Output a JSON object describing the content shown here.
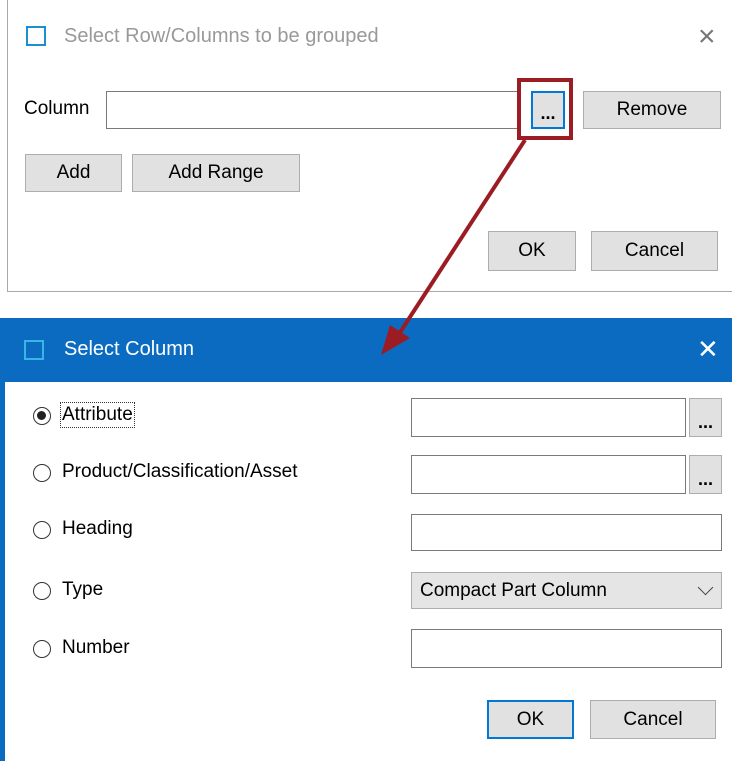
{
  "dialog_group": {
    "title": "Select Row/Columns to be grouped",
    "column_label": "Column",
    "column_value": "",
    "browse_label": "...",
    "remove_label": "Remove",
    "add_label": "Add",
    "add_range_label": "Add Range",
    "ok_label": "OK",
    "cancel_label": "Cancel",
    "close_icon": "×"
  },
  "dialog_column": {
    "title": "Select Column",
    "close_icon": "✕",
    "options": [
      {
        "label": "Attribute",
        "selected": true
      },
      {
        "label": "Product/Classification/Asset",
        "selected": false
      },
      {
        "label": "Heading",
        "selected": false
      },
      {
        "label": "Type",
        "selected": false
      },
      {
        "label": "Number",
        "selected": false
      }
    ],
    "attribute_value": "",
    "product_value": "",
    "heading_value": "",
    "type_value": "Compact Part Column",
    "number_value": "",
    "browse_label": "...",
    "ok_label": "OK",
    "cancel_label": "Cancel"
  },
  "colors": {
    "accent": "#0a6bc1",
    "annotation": "#9b1c23",
    "button_bg": "#e1e1e1"
  }
}
